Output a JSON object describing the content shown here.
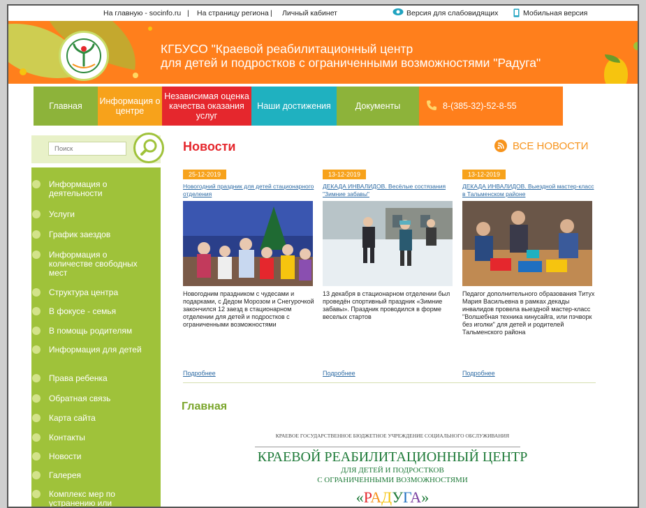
{
  "topbar": {
    "home_link": "На главную - socinfo.ru",
    "sep1": "|",
    "region_link": "На страницу региона",
    "sep2": "|",
    "cabinet_link": "Личный кабинет",
    "low_vision": "Версия для слабовидящих",
    "mobile": "Мобильная версия"
  },
  "header": {
    "title_line1": "КГБУСО \"Краевой реабилитационный центр",
    "title_line2": "для детей и подростков с ограниченными возможностями \"Радуга\""
  },
  "nav": {
    "items": [
      {
        "label": "Главная",
        "color": "#8db33a"
      },
      {
        "label": "Информация о центре",
        "color": "#f7a21b"
      },
      {
        "label": "Независимая оценка качества оказания услуг",
        "color": "#e5272d"
      },
      {
        "label": "Наши достижения",
        "color": "#1fb1c0"
      },
      {
        "label": "Документы",
        "color": "#8db33a"
      }
    ],
    "phone": "8-(385-32)-52-8-55"
  },
  "search": {
    "placeholder": "Поиск"
  },
  "sidebar": {
    "items": [
      {
        "label": "Информация о деятельности"
      },
      {
        "label": "Услуги"
      },
      {
        "label": "График заездов"
      },
      {
        "label": "Информация о количестве свободных мест"
      },
      {
        "label": "Структура центра"
      },
      {
        "label": "В фокусе - семья"
      },
      {
        "label": "В помощь родителям"
      },
      {
        "label": "Информация для детей"
      },
      {
        "label": "Права ребенка"
      },
      {
        "label": "Обратная связь"
      },
      {
        "label": "Карта сайта"
      },
      {
        "label": "Контакты"
      },
      {
        "label": "Новости"
      },
      {
        "label": "Галерея"
      },
      {
        "label": "Комплекс мер по устранению или минимизации"
      }
    ]
  },
  "news": {
    "title": "Новости",
    "all_news": "ВСЕ НОВОСТИ",
    "more_label": "Подробнее",
    "cards": [
      {
        "date": "25-12-2019",
        "headline": "Новогодний праздник для детей стационарного отделения",
        "text": "Новогодним праздником с чудесами и подарками, с Дедом Морозом и Снегурочкой закончился 12 заезд в стационарном отделении для детей и подростков с ограниченными возможностями"
      },
      {
        "date": "13-12-2019",
        "headline": "ДЕКАДА ИНВАЛИДОВ. Весёлые состязания \"Зимние забавы\"",
        "text": "13 декабря в стационарном отделении был проведён спортивный праздник «Зимние забавы». Праздник проводился в форме веселых стартов"
      },
      {
        "date": "13-12-2019",
        "headline": "ДЕКАДА ИНВАЛИДОВ. Выездной мастер-класс в Тальменском районе",
        "text": "Педагог дополнительного образования Титух Мария Васильевна в рамках декады инвалидов провела выездной мастер-класс \"Волшебная техника кинусайга, или пэчворк без иголки\" для детей и родителей Тальменского района"
      }
    ]
  },
  "main": {
    "title": "Главная",
    "org_small": "КРАЕВОЕ ГОСУДАРСТВЕННОЕ БЮДЖЕТНОЕ УЧРЕЖДЕНИЕ СОЦИАЛЬНОГО ОБСЛУЖИВАНИЯ",
    "org_big": "КРАЕВОЙ РЕАБИЛИТАЦИОННЫЙ ЦЕНТР",
    "org_sub1": "ДЛЯ ДЕТЕЙ И ПОДРОСТКОВ",
    "org_sub2": "С ОГРАНИЧЕННЫМИ ВОЗМОЖНОСТЯМИ",
    "raduga_open": "«",
    "raduga_letters": [
      "Р",
      "А",
      "Д",
      "У",
      "Г",
      "А"
    ],
    "raduga_close": "»",
    "raduga_colors": [
      "#e5272d",
      "#f7941d",
      "#f6c40f",
      "#1e7a38",
      "#1f6fc0",
      "#7a3fa0"
    ]
  }
}
